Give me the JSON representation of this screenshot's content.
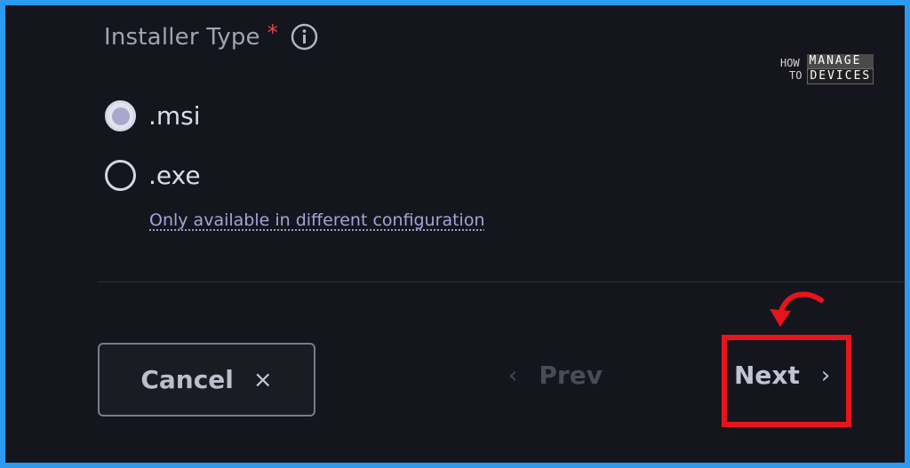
{
  "form": {
    "field_label": "Installer Type",
    "required_mark": "*",
    "options": [
      {
        "label": ".msi",
        "checked": true
      },
      {
        "label": ".exe",
        "checked": false
      }
    ],
    "help_link": "Only available in different configuration"
  },
  "footer": {
    "cancel_label": "Cancel",
    "cancel_icon": "×",
    "prev_label": "Prev",
    "prev_icon": "‹",
    "next_label": "Next",
    "next_icon": "›"
  },
  "watermark": {
    "line1": "HOW",
    "line2": "TO",
    "line3": "MANAGE",
    "line4": "DEVICES"
  },
  "colors": {
    "background": "#15151d",
    "frame": "#2b9af3",
    "highlight": "#e8141b",
    "accent_link": "#a6a4d6"
  }
}
